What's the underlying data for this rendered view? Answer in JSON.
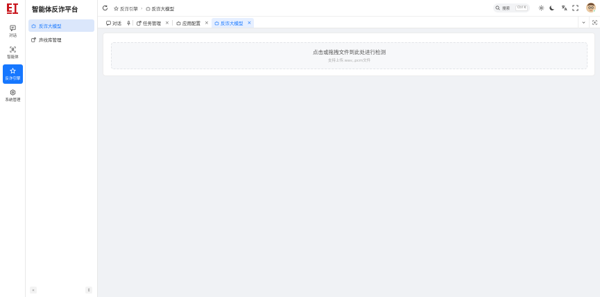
{
  "rail": {
    "items": [
      {
        "label": "对话",
        "icon": "chat-icon"
      },
      {
        "label": "智能体",
        "icon": "agent-icon"
      },
      {
        "label": "反诈引擎",
        "icon": "engine-icon"
      },
      {
        "label": "系统管理",
        "icon": "settings-icon"
      }
    ],
    "active_index": 2
  },
  "sidebar": {
    "title": "智能体反诈平台",
    "items": [
      {
        "label": "反诈大模型",
        "icon": "model-icon"
      },
      {
        "label": "声纹库管理",
        "icon": "voiceprint-icon"
      }
    ],
    "active_index": 0
  },
  "header": {
    "breadcrumb": [
      {
        "label": "反诈引擎",
        "icon": "engine-icon"
      },
      {
        "label": "反诈大模型",
        "icon": "model-icon"
      }
    ],
    "search": {
      "label": "搜索",
      "shortcut": "Ctrl K"
    }
  },
  "tabs": [
    {
      "label": "对话",
      "icon": "chat-icon",
      "pinned": true
    },
    {
      "label": "任务管理",
      "icon": "task-icon"
    },
    {
      "label": "应用配置",
      "icon": "app-icon"
    },
    {
      "label": "反诈大模型",
      "icon": "model-icon",
      "active": true
    }
  ],
  "upload": {
    "title": "点击或拖拽文件到此处进行检测",
    "hint": "支持上传.wav,.pcm文件"
  },
  "colors": {
    "accent": "#1677ff",
    "active_bg": "#dbe7fb",
    "logo_red": "#c8161d"
  }
}
